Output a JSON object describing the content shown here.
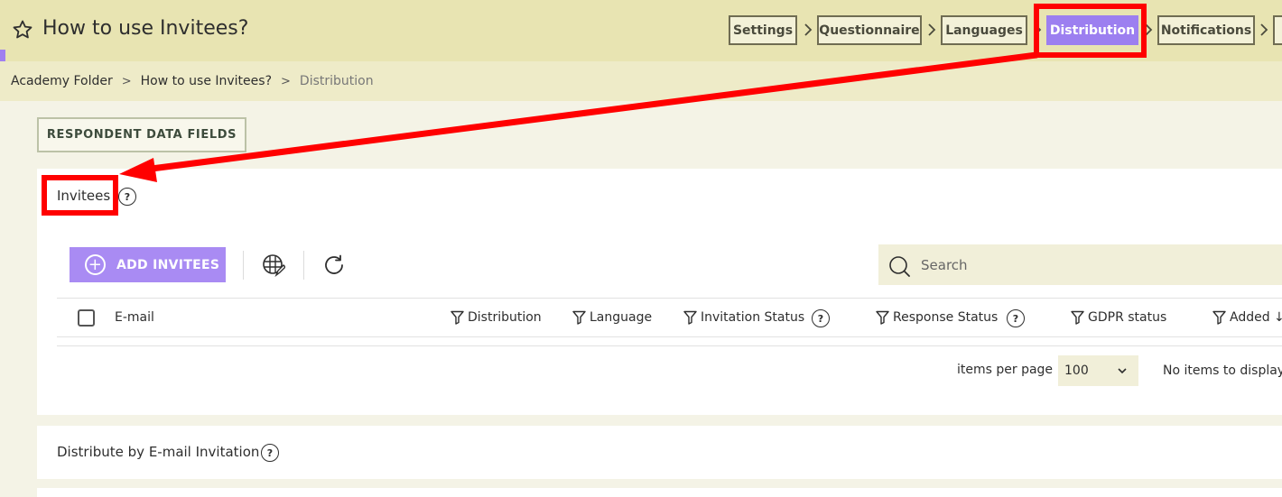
{
  "header": {
    "title": "How to use Invitees?",
    "steps": [
      {
        "label": "Settings",
        "active": false
      },
      {
        "label": "Questionnaire",
        "active": false
      },
      {
        "label": "Languages",
        "active": false
      },
      {
        "label": "Distribution",
        "active": true
      },
      {
        "label": "Notifications",
        "active": false
      }
    ]
  },
  "breadcrumb": {
    "items": [
      "Academy Folder",
      "How to use Invitees?",
      "Distribution"
    ]
  },
  "respondent_data_fields_label": "RESPONDENT DATA FIELDS",
  "invitees": {
    "title": "Invitees",
    "help": "?",
    "add_label": "ADD INVITEES",
    "search_placeholder": "Search",
    "columns": {
      "email": "E-mail",
      "distribution": "Distribution",
      "language": "Language",
      "invitation_status": "Invitation Status",
      "response_status": "Response Status",
      "gdpr_status": "GDPR status",
      "added": "Added ↓"
    },
    "items_per_page_label": "items per page",
    "items_per_page_value": "100",
    "no_items_text": "No items to display"
  },
  "email_invitation": {
    "title": "Distribute by E-mail Invitation",
    "help": "?"
  },
  "colors": {
    "accent": "#9c7ff0",
    "header_bg": "#e8e4b2",
    "annotation": "#ff0000"
  },
  "icons": {
    "favorite": "star-icon",
    "add": "plus-circle-icon",
    "columns": "table-edit-icon",
    "refresh": "refresh-icon",
    "search": "search-icon",
    "filter": "filter-icon",
    "dropdown": "chevron-down-icon"
  }
}
